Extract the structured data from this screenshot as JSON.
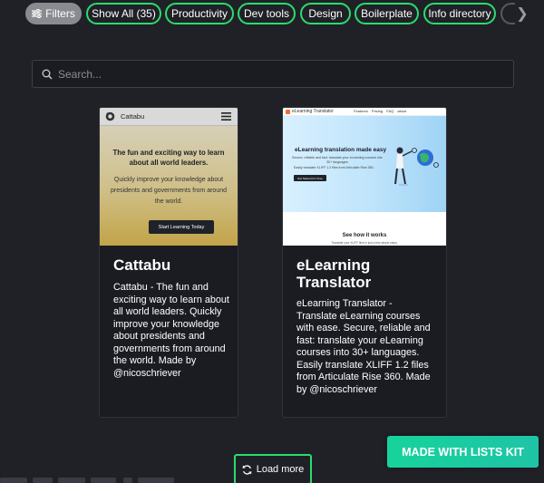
{
  "filters": {
    "filters_label": "Filters",
    "chips": [
      {
        "label": "Show All (35)"
      },
      {
        "label": "Productivity"
      },
      {
        "label": "Dev tools"
      },
      {
        "label": "Design"
      },
      {
        "label": "Boilerplate"
      },
      {
        "label": "Info directory"
      }
    ],
    "next_arrow": "❯"
  },
  "search": {
    "placeholder": "Search...",
    "value": ""
  },
  "cards": [
    {
      "title": "Cattabu",
      "description": "Cattabu - The fun and exciting way to learn about all world leaders. Quickly improve your knowledge about presidents and governments from around the world. Made by @nicoschriever",
      "thumbnail": {
        "brand": "Cattabu",
        "heading": "The fun and exciting way to learn about all world leaders.",
        "subheading": "Quickly improve your knowledge about presidents and governments from around the world.",
        "button": "Start Learning Today"
      }
    },
    {
      "title": "eLearning Translator",
      "description": "eLearning Translator - Translate eLearning courses with ease. Secure, reliable and fast: translate your eLearning courses into 30+ languages. Easily translate XLIFF 1.2 files from Articulate Rise 360. Made by @nicoschriever",
      "thumbnail": {
        "brand": "eLearning Translator",
        "nav": "Features Pricing FAQ about",
        "hero_title": "eLearning translation made easy",
        "hero_sub": "Secure, reliable and fast: translate your eLearning courses into 30+ languages",
        "hero_sub2": "Easily translate XLIFF 1.2 files from Articulate Rise 360.",
        "hero_button": "Get Started For Free",
        "section_title": "See how it works",
        "section_sub": "Translate your XLIFF files in just a few simple steps."
      }
    }
  ],
  "load_more": "Load more",
  "made_with": "MADE WITH LISTS KIT",
  "colors": {
    "background": "#202127",
    "accent_green": "#2bdc6e",
    "badge_teal": "#17d39b"
  }
}
